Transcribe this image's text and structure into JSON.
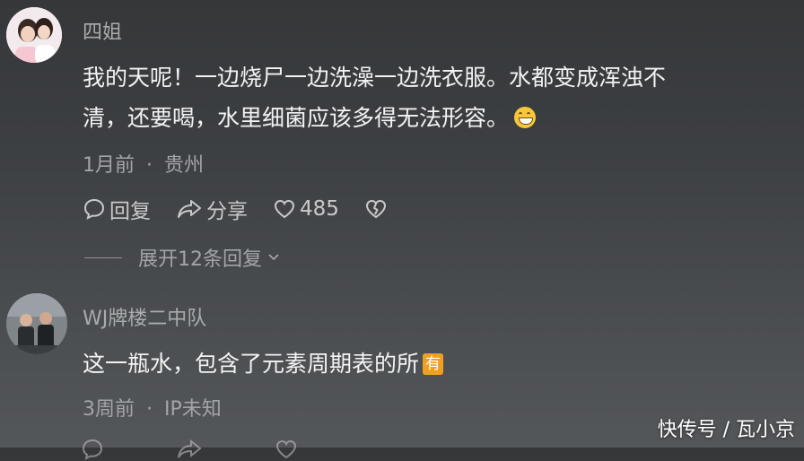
{
  "comments": [
    {
      "username": "四姐",
      "text_line1": "我的天呢！一边烧尸一边洗澡一边洗衣服。水都变成浑浊不",
      "text_line2": "清，还要喝，水里细菌应该多得无法形容。",
      "emoji": "grinning-face-emoji",
      "time": "1月前",
      "separator": "·",
      "location": "贵州",
      "reply_label": "回复",
      "share_label": "分享",
      "like_count": "485",
      "expand_label": "展开12条回复"
    },
    {
      "username": "WJ牌楼二中队",
      "text": "这一瓶水，包含了元素周期表的所",
      "badge": "有",
      "time": "3周前",
      "separator": "·",
      "location": "IP未知"
    }
  ],
  "watermark": "快传号 / 瓦小京",
  "colors": {
    "background": "#3d4043",
    "text": "#f3f3f3",
    "meta": "#a2a4a6",
    "badge": "#f0a020"
  }
}
